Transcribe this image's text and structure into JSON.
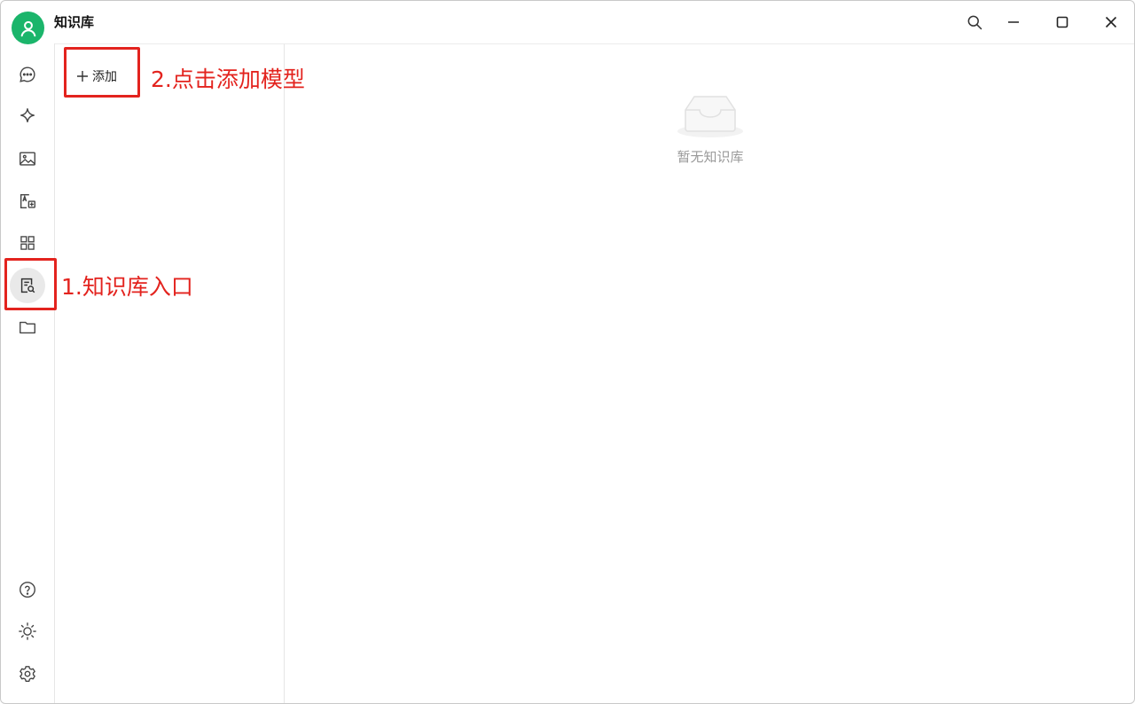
{
  "window": {
    "title": "知识库"
  },
  "sidebar": {
    "items": [
      {
        "icon": "chat-icon"
      },
      {
        "icon": "sparkle-icon"
      },
      {
        "icon": "image-icon"
      },
      {
        "icon": "translate-icon"
      },
      {
        "icon": "apps-grid-icon"
      },
      {
        "icon": "knowledge-base-icon",
        "active": true
      },
      {
        "icon": "folder-icon"
      }
    ],
    "bottom_items": [
      {
        "icon": "help-icon"
      },
      {
        "icon": "theme-sun-icon"
      },
      {
        "icon": "settings-gear-icon"
      }
    ]
  },
  "list_pane": {
    "add_label": "添加",
    "add_icon": "plus-icon"
  },
  "main": {
    "empty_text": "暂无知识库",
    "empty_icon": "empty-inbox-icon"
  },
  "annotations": {
    "step1": "1.知识库入口",
    "step2": "2.点击添加模型",
    "color": "#e3231e"
  },
  "colors": {
    "brand": "#1bb56b",
    "active_bg": "#e9e9e9"
  }
}
